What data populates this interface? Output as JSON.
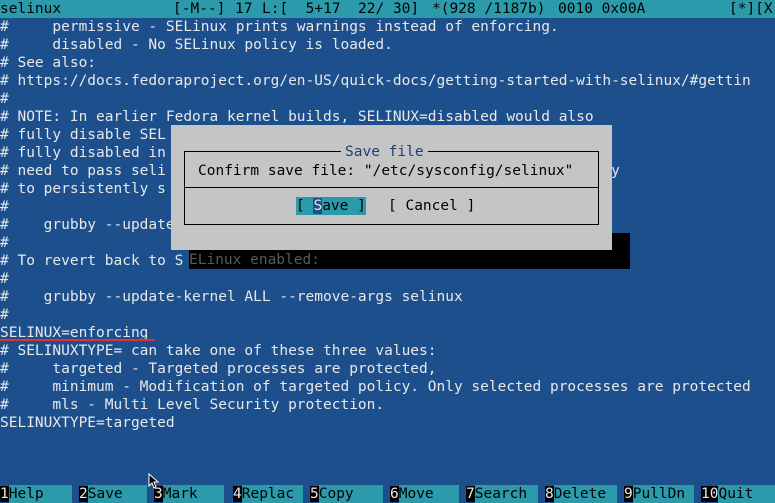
{
  "status": {
    "filename": "selinux",
    "mode": "[-M--]",
    "column": "17",
    "line_info": "L:[  5+17  22/ 30]",
    "offset": "*(928 /1187b)",
    "char_code": "0010 0x00A",
    "flags": "[*][X]"
  },
  "lines": [
    "#     permissive - SELinux prints warnings instead of enforcing.",
    "#     disabled - No SELinux policy is loaded.",
    "# See also:",
    "# https://docs.fedoraproject.org/en-US/quick-docs/getting-started-with-selinux/#gettin",
    "#",
    "# NOTE: In earlier Fedora kernel builds, SELINUX=disabled would also",
    "# fully disable SEL                                                 ux",
    "# fully disabled in                                                 ou",
    "# need to pass seli                                                 bby",
    "# to persistently s",
    "#",
    "#    grubby --update",
    "#",
    "# To revert back to S",
    "#",
    "#    grubby --update-kernel ALL --remove-args selinux",
    "#",
    "SELINUX=enforcing",
    "# SELINUXTYPE= can take one of these three values:",
    "#     targeted - Targeted processes are protected,",
    "#     minimum - Modification of targeted policy. Only selected processes are protected",
    "#     mls - Multi Level Security protection.",
    "SELINUXTYPE=targeted"
  ],
  "shadow_text": "ELinux enabled:",
  "dialog": {
    "title": "Save file",
    "message": "Confirm save file: \"/etc/sysconfig/selinux\"",
    "save_open": "[ ",
    "save_hotkey": "S",
    "save_rest": "ave ]",
    "cancel_label": "[ Cancel ]"
  },
  "keybar": [
    {
      "num": "1",
      "label": "Help"
    },
    {
      "num": "2",
      "label": "Save"
    },
    {
      "num": "3",
      "label": "Mark"
    },
    {
      "num": "4",
      "label": "Replac"
    },
    {
      "num": "5",
      "label": "Copy"
    },
    {
      "num": "6",
      "label": "Move"
    },
    {
      "num": "7",
      "label": "Search"
    },
    {
      "num": "8",
      "label": "Delete"
    },
    {
      "num": "9",
      "label": "PullDn"
    },
    {
      "num": "10",
      "label": "Quit"
    }
  ],
  "colors": {
    "background": "#1c4f8c",
    "status_bar": "#2b9bab",
    "dialog": "#c5c5c5",
    "underline": "#e53030"
  }
}
